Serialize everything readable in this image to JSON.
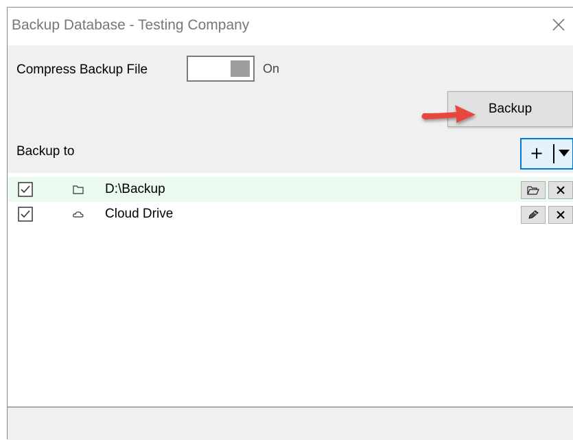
{
  "window": {
    "title": "Backup Database - Testing Company"
  },
  "compress": {
    "label": "Compress Backup File",
    "state_text": "On",
    "enabled": true
  },
  "actions": {
    "backup_label": "Backup",
    "add_label": "+"
  },
  "destinations": {
    "header": "Backup to",
    "items": [
      {
        "label": "D:\\Backup",
        "checked": true,
        "icon": "folder-icon",
        "action_icon": "folder-open-icon",
        "selected": true
      },
      {
        "label": "Cloud Drive",
        "checked": true,
        "icon": "cloud-icon",
        "action_icon": "edit-icon",
        "selected": false
      }
    ]
  },
  "colors": {
    "accent": "#0078d7",
    "selected_row": "#eafaee",
    "arrow": "#e8463c"
  }
}
